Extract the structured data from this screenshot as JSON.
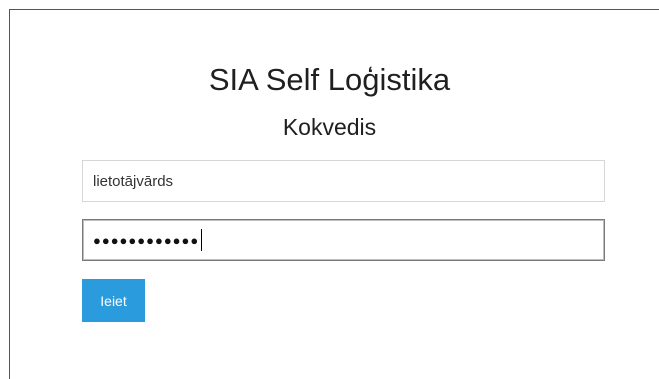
{
  "login": {
    "company_name": "SIA Self Loģistika",
    "page_title": "Kokvedis",
    "username_value": "lietotājvārds",
    "password_mask": "●●●●●●●●●●●●",
    "submit_label": "Ieiet"
  },
  "colors": {
    "button_bg": "#2a9bdc",
    "button_text": "#ffffff",
    "input_border": "#d6d6d6",
    "focused_border": "#7a7a7a"
  }
}
